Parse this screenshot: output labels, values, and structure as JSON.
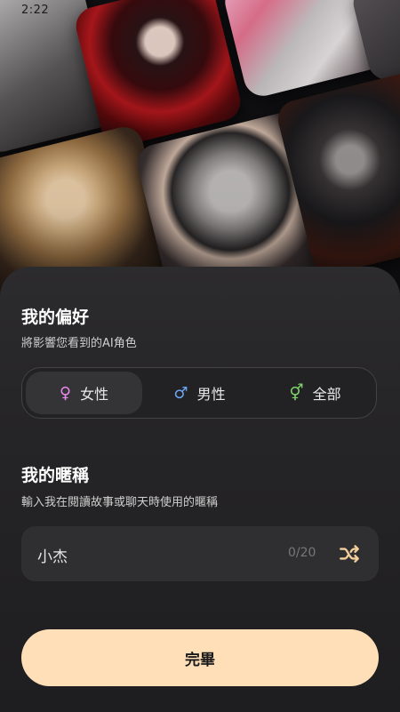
{
  "status_bar": {
    "time": "2:22"
  },
  "colors": {
    "accent_button": "#fedfb8",
    "female_icon": "#e889ec",
    "male_icon": "#6aa5f2",
    "all_icon": "#7ed36a",
    "shuffle_icon": "#f3cf9c"
  },
  "preferences": {
    "title": "我的偏好",
    "subtitle": "將影響您看到的AI角色",
    "options": [
      {
        "icon": "female-icon",
        "symbol": "♀",
        "label": "女性",
        "selected": true
      },
      {
        "icon": "male-icon",
        "symbol": "♂",
        "label": "男性",
        "selected": false
      },
      {
        "icon": "all-genders-icon",
        "symbol": "⚥",
        "label": "全部",
        "selected": false
      }
    ]
  },
  "nickname": {
    "title": "我的暱稱",
    "subtitle": "輸入我在閱讀故事或聊天時使用的暱稱",
    "value": "小杰",
    "counter": "0/20",
    "shuffle_icon": "shuffle-icon"
  },
  "done_button": {
    "label": "完畢"
  }
}
